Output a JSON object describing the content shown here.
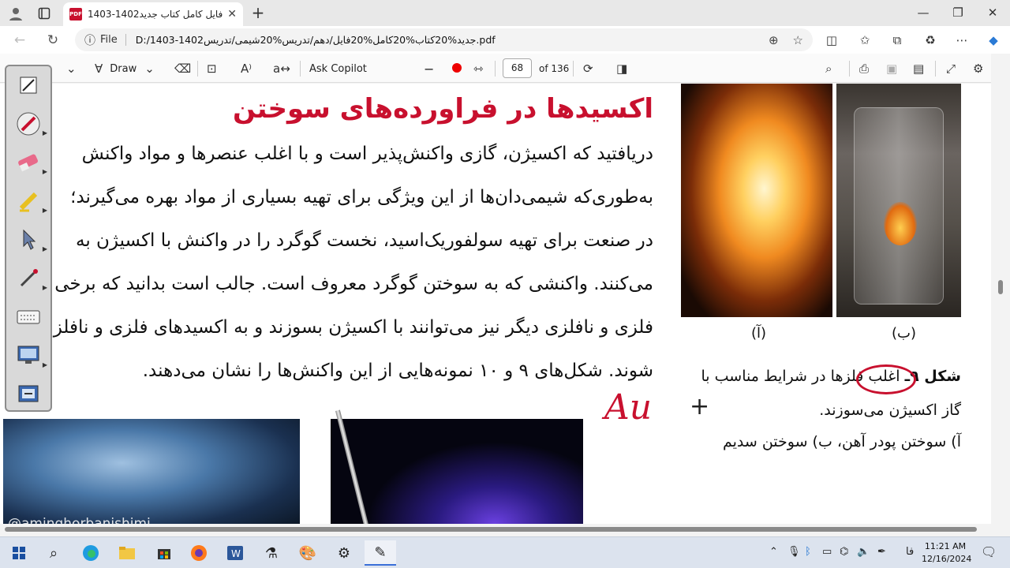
{
  "browser": {
    "tab_title": "فایل کامل کتاب جدید1402-1403.pdf",
    "tab_icon": "PDF",
    "file_label": "File",
    "url": "D:/1403-1402جدید%20کتاب%20کامل%20فایل/دهم/تدریس%20شیمی/تدریس.pdf"
  },
  "pdf_toolbar": {
    "draw_label": "Draw",
    "copilot_label": "Ask Copilot",
    "minus": "−",
    "page_number": "68",
    "page_total": "of 136"
  },
  "document": {
    "heading": "اکسیدها در فراورده‌های سوختن",
    "paragraph": [
      "دریافتید که اکسیژن، گازی واکنش‌پذیر است و با اغلب عنصرها و مواد واکنش",
      "به‌طوری‌که شیمی‌دان‌ها از این ویژگی برای تهیه بسیاری از مواد بهره می‌گیرند؛",
      "در صنعت برای تهیه سولفوریک‌اسید، نخست گوگرد را در واکنش با اکسیژن به",
      "می‌کنند. واکنشی که به سوختن گوگرد معروف است. جالب است بدانید که برخی",
      "فلزی و نافلزی دیگر نیز می‌توانند با اکسیژن بسوزند و به اکسیدهای فلزی و نافلز",
      "شوند. شکل‌های ۹ و ۱۰ نمونه‌هایی از این واکنش‌ها را نشان می‌دهند."
    ],
    "fig_label_a": "(آ)",
    "fig_label_b": "(ب)",
    "caption_title": "شکل ۹ـ",
    "caption_line1": "اغلب فلزها در شرایط مناسب با",
    "caption_line2": "گاز اکسیژن می‌سوزند.",
    "caption_line3": "آ) سوختن پودر آهن، ب) سوختن سدیم",
    "handwriting": "Au",
    "plus_mark": "+",
    "watermark": "@aminghorbanishimi"
  },
  "taskbar": {
    "time": "11:21 AM",
    "date": "12/16/2024",
    "lang": "فا"
  }
}
